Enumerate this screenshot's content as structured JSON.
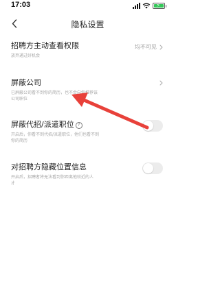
{
  "status_bar": {
    "time": "17:03"
  },
  "nav": {
    "title": "隐私设置"
  },
  "settings": [
    {
      "title": "招聘方主动查看权限",
      "desc": "放弃通过好机会",
      "value": "均不可见"
    },
    {
      "title": "屏蔽公司",
      "desc_lines": [
        "已屏蔽公司看不到你的简历，也不会向你推荐该",
        "公司职位"
      ]
    },
    {
      "title": "屏蔽代招/派遣职位",
      "desc_lines": [
        "开启后，你看不到代招/派遣职位，他们也看不到",
        "你的简历"
      ],
      "toggle_on": false
    },
    {
      "title": "对招聘方隐藏位置信息",
      "desc_lines": [
        "开启后，招聘者将无法看到你距离他较近的人",
        "才"
      ],
      "toggle_on": false
    }
  ],
  "annotation": {
    "arrow_color": "#e8413a"
  }
}
